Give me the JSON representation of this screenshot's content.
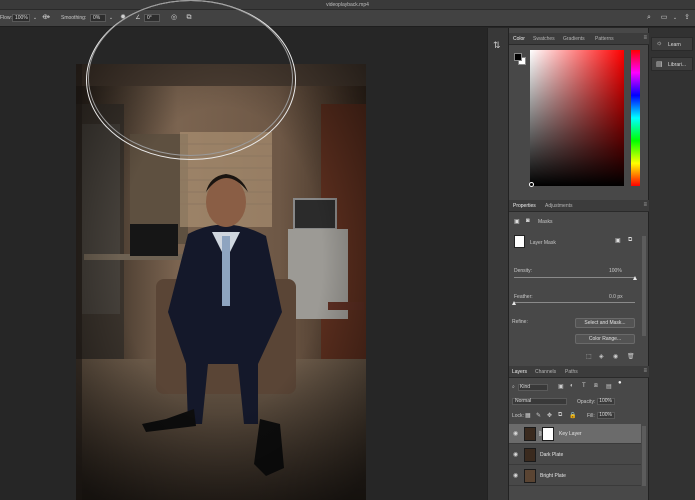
{
  "window": {
    "title": "videoplayback.mp4"
  },
  "options_bar": {
    "flow_label": "Flow:",
    "flow_value": "100%",
    "smoothing_label": "Smoothing:",
    "smoothing_value": "0%",
    "angle_value": "0°"
  },
  "color_panel": {
    "tabs": [
      "Color",
      "Swatches",
      "Gradients",
      "Patterns"
    ],
    "active_tab": "Color",
    "foreground": "#000000",
    "background": "#ffffff",
    "hue_color": "#ff0000"
  },
  "properties_panel": {
    "tabs": [
      "Properties",
      "Adjustments"
    ],
    "section_label": "Masks",
    "mask_type_label": "Layer Mask",
    "density_label": "Density:",
    "density_value": "100%",
    "density_level": 1.0,
    "feather_label": "Feather:",
    "feather_value": "0.0 px",
    "feather_level": 0.0,
    "refine_label": "Refine:",
    "select_and_mask_label": "Select and Mask...",
    "color_range_label": "Color Range..."
  },
  "layers_panel": {
    "tabs": [
      "Layers",
      "Channels",
      "Paths"
    ],
    "filter_label": "Kind",
    "blend_mode": "Normal",
    "opacity_label": "Opacity:",
    "opacity_value": "100%",
    "lock_label": "Lock:",
    "fill_label": "Fill:",
    "fill_value": "100%",
    "layers": [
      {
        "name": "Key Layer",
        "has_mask": true,
        "active": true
      },
      {
        "name": "Dark Plate",
        "has_mask": false,
        "active": false
      },
      {
        "name": "Bright Plate",
        "has_mask": false,
        "active": false
      }
    ]
  },
  "right_column": {
    "items": [
      {
        "label": "Learn",
        "icon": "lightbulb-icon"
      },
      {
        "label": "Librari...",
        "icon": "libraries-icon"
      }
    ]
  }
}
